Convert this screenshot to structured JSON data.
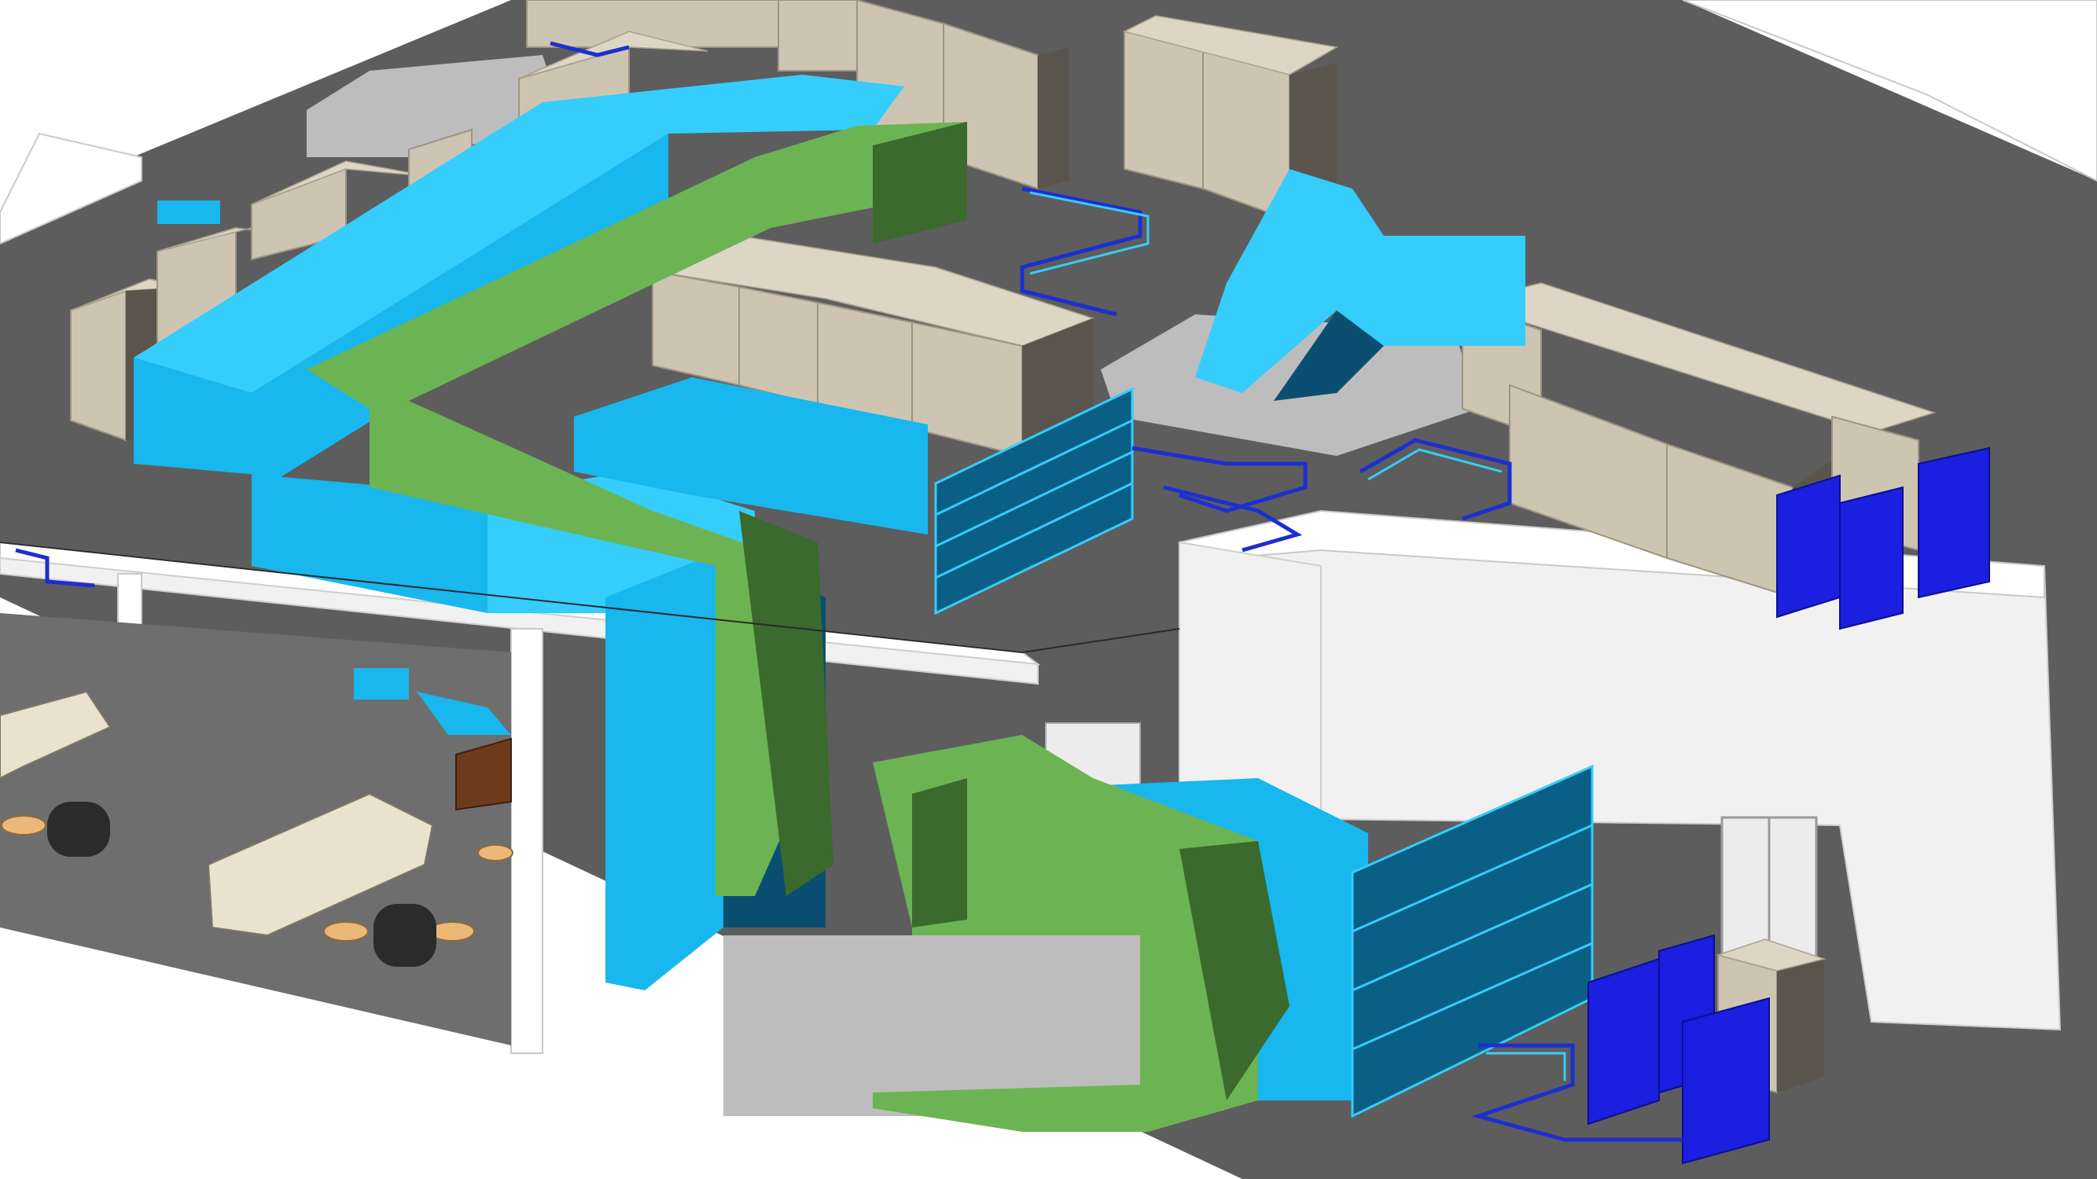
{
  "scene": {
    "background": "#ffffff",
    "colors": {
      "supply_duct": "#18b7ee",
      "return_duct": "#6cb453",
      "outdoor_unit": "#1a1fe0",
      "indoor_cabinet": "#cdc5b2",
      "floor": "#5d5d5d"
    },
    "objects": [
      "supply-air-duct",
      "return-air-duct",
      "precision-ac-cabinet-row",
      "outdoor-condensing-unit",
      "refrigerant-pipework",
      "louvered-grille",
      "lounge-area"
    ]
  }
}
